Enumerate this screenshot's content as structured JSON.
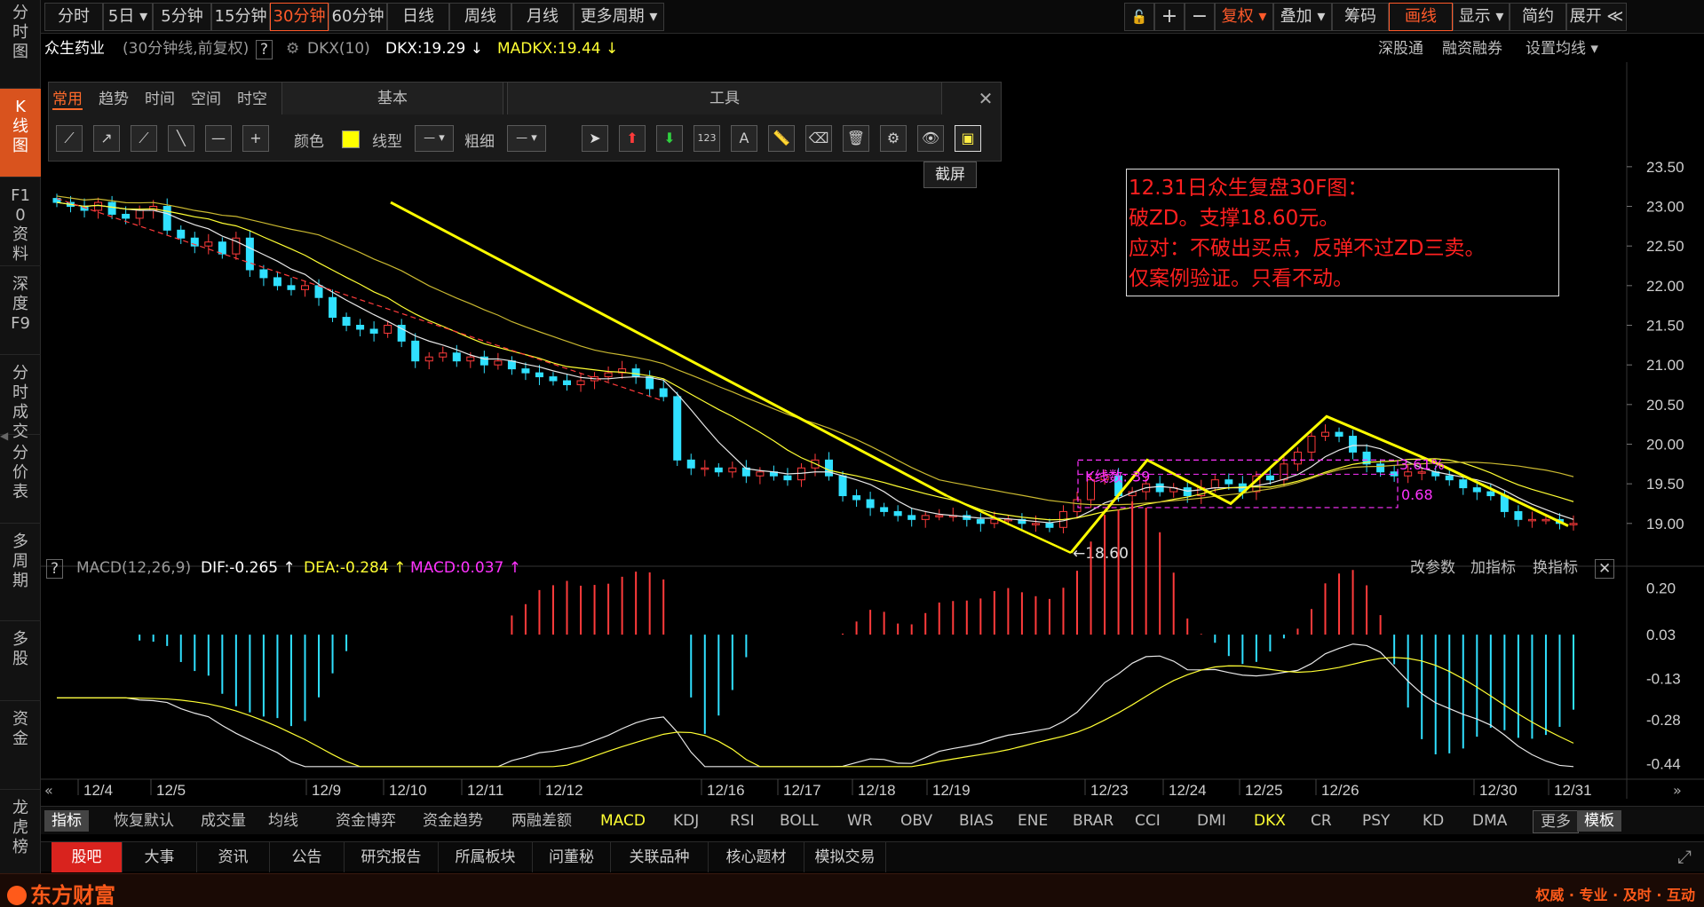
{
  "left_nav": [
    {
      "label": "分时图",
      "active": false
    },
    {
      "label": "K线图",
      "active": true
    },
    {
      "label": "F10资料",
      "active": false
    },
    {
      "label": "深度F9",
      "active": false
    },
    {
      "label": "分时成交",
      "active": false
    },
    {
      "label": "分价表",
      "active": false
    },
    {
      "label": "多周期",
      "active": false
    },
    {
      "label": "多股",
      "active": false
    },
    {
      "label": "资金",
      "active": false
    },
    {
      "label": "龙虎榜",
      "active": false
    }
  ],
  "toolbar": {
    "periods": [
      "分时",
      "5日 ▾",
      "5分钟",
      "15分钟",
      "30分钟",
      "60分钟",
      "日线",
      "周线",
      "月线",
      "更多周期 ▾"
    ],
    "active_period": "30分钟",
    "right": [
      "复权 ▾",
      "叠加 ▾",
      "筹码",
      "画线",
      "显示 ▾",
      "简约",
      "展开 ≪"
    ],
    "zoom_in": "+",
    "zoom_out": "−",
    "lock_icon": "lock-icon"
  },
  "info": {
    "stock_name": "众生药业",
    "period_desc": "(30分钟线,前复权)",
    "help": "?",
    "indicator": "DKX(10)",
    "dkx": "DKX:19.29",
    "madkx": "MADKX:19.44",
    "links": [
      "深股通",
      "融资融券",
      "设置均线 ▾"
    ]
  },
  "drawbox": {
    "tabs": [
      "常用",
      "趋势",
      "时间",
      "空间",
      "时空"
    ],
    "basic_title": "基本",
    "tools_title": "工具",
    "color_label": "颜色",
    "color_value": "#ffff00",
    "linetype_label": "线型",
    "weight_label": "粗细",
    "tooltip": "截屏",
    "close": "✕"
  },
  "annotation": [
    "12.31日众生复盘30F图：",
    "破ZD。支撑18.60元。",
    "应对：不破出买点，反弹不过ZD三卖。",
    "仅案例验证。只看不动。"
  ],
  "chart_marks": {
    "low_label": "←18.60",
    "kline_count": "K线数: 39",
    "pct": "3.61%",
    "range": "0.68"
  },
  "price_axis": [
    "23.50",
    "23.00",
    "22.50",
    "22.00",
    "21.50",
    "21.00",
    "20.50",
    "20.00",
    "19.50",
    "19.00"
  ],
  "macd_axis": [
    "0.20",
    "0.03",
    "-0.13",
    "-0.28",
    "-0.44"
  ],
  "date_axis": [
    "12/4",
    "12/5",
    "12/9",
    "12/10",
    "12/11",
    "12/12",
    "12/16",
    "12/17",
    "12/18",
    "12/19",
    "12/23",
    "12/24",
    "12/25",
    "12/26",
    "12/30",
    "12/31"
  ],
  "macd": {
    "help": "?",
    "title": "MACD(12,26,9)",
    "dif": "DIF:-0.265",
    "dea": "DEA:-0.284",
    "macd": "MACD:0.037",
    "links": [
      "改参数",
      "加指标",
      "换指标"
    ],
    "close": "✕"
  },
  "indicators": {
    "first": "指标",
    "items": [
      "恢复默认",
      "成交量",
      "均线",
      "资金博弈",
      "资金趋势",
      "两融差额",
      "MACD",
      "KDJ",
      "RSI",
      "BOLL",
      "WR",
      "OBV",
      "BIAS",
      "ENE",
      "BRAR",
      "CCI",
      "DMI",
      "DKX",
      "CR",
      "PSY",
      "KD",
      "DMA"
    ],
    "more": "更多",
    "template": "模板"
  },
  "bottom_tabs": [
    "股吧",
    "大事",
    "资讯",
    "公告",
    "研究报告",
    "所属板块",
    "问董秘",
    "关联品种",
    "核心题材",
    "模拟交易"
  ],
  "footer": {
    "logo": "东方财富",
    "slogan": "权威 · 专业 · 及时 · 互动"
  },
  "colors": {
    "up": "#ff3b3b",
    "down": "#30e0ff",
    "yellow_line": "#ffff00",
    "accent": "#ff5a2a",
    "magenta": "#ff33ff"
  },
  "chart_data": {
    "type": "candlestick",
    "price_ylim": [
      18.55,
      23.7
    ],
    "macd_ylim": [
      -0.47,
      0.24
    ],
    "closes": [
      23.05,
      23.0,
      22.95,
      23.05,
      22.9,
      22.85,
      22.95,
      23.0,
      22.7,
      22.6,
      22.5,
      22.55,
      22.4,
      22.6,
      22.2,
      22.1,
      22.0,
      21.95,
      22.0,
      21.85,
      21.6,
      21.5,
      21.45,
      21.4,
      21.5,
      21.3,
      21.05,
      21.1,
      21.15,
      21.05,
      21.1,
      21.0,
      21.05,
      20.95,
      20.9,
      20.85,
      20.8,
      20.75,
      20.8,
      20.85,
      20.9,
      20.95,
      20.85,
      20.7,
      20.6,
      19.8,
      19.7,
      19.7,
      19.65,
      19.7,
      19.6,
      19.65,
      19.6,
      19.55,
      19.7,
      19.8,
      19.6,
      19.35,
      19.3,
      19.2,
      19.15,
      19.1,
      19.05,
      19.1,
      19.1,
      19.1,
      19.05,
      19.0,
      19.05,
      19.05,
      19.0,
      19.0,
      18.95,
      19.15,
      19.3,
      19.55,
      19.6,
      19.35,
      19.4,
      19.5,
      19.4,
      19.45,
      19.35,
      19.45,
      19.55,
      19.5,
      19.4,
      19.6,
      19.55,
      19.75,
      19.9,
      20.1,
      20.15,
      20.1,
      19.9,
      19.75,
      19.65,
      19.6,
      19.65,
      19.65,
      19.6,
      19.55,
      19.45,
      19.4,
      19.35,
      19.15,
      19.05,
      19.05,
      19.05,
      19.0,
      19.0
    ]
  }
}
